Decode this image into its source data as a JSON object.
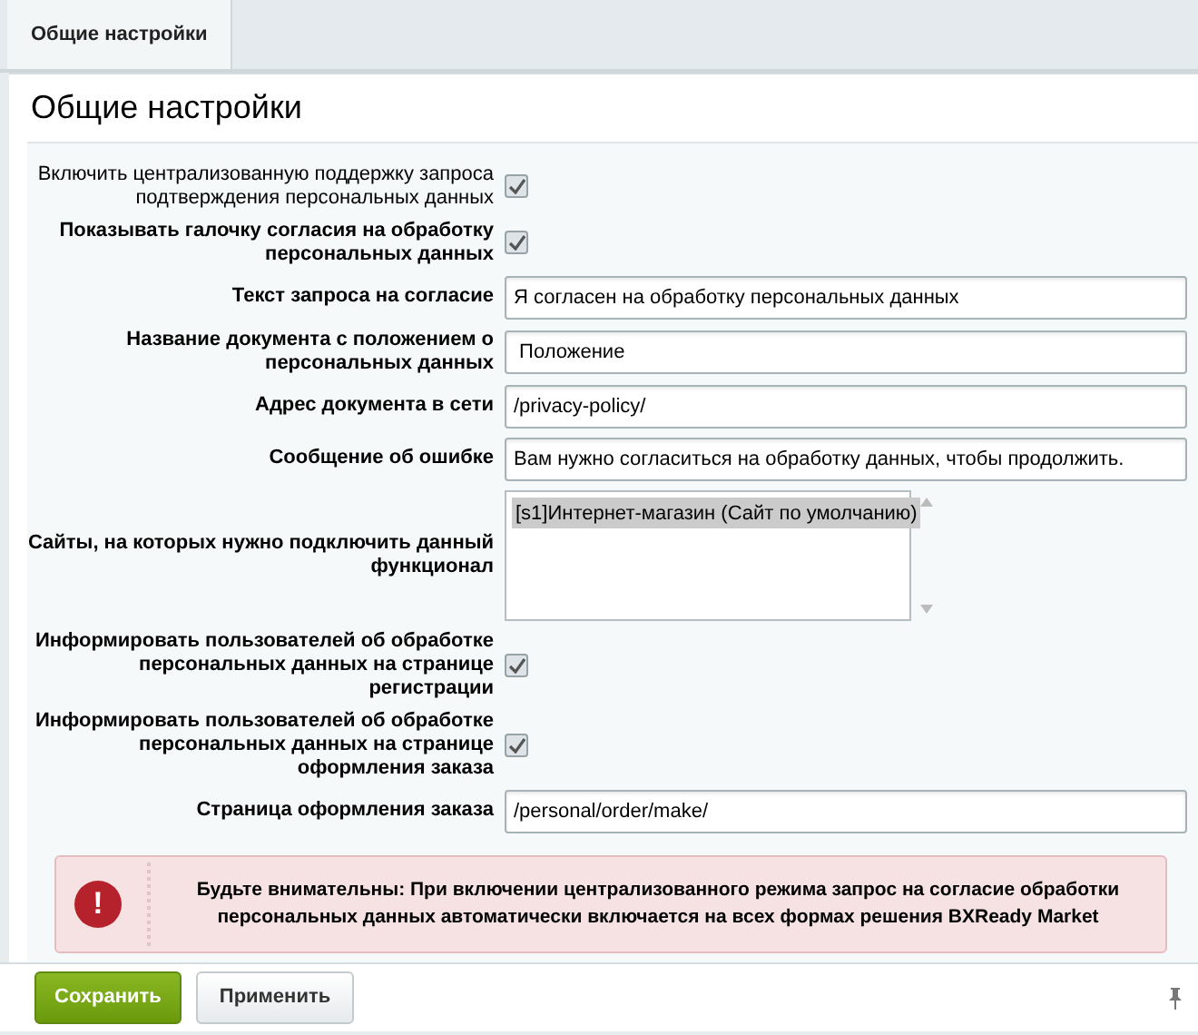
{
  "tabs": [
    {
      "label": "Общие настройки",
      "selected": true
    }
  ],
  "title": "Общие настройки",
  "fields": [
    {
      "kind": "checkbox",
      "label": "Включить централизованную поддержку запроса подтверждения персональных данных",
      "bold": false,
      "checked": true
    },
    {
      "kind": "checkbox",
      "label": "Показывать галочку согласия на обработку персональных данных",
      "bold": true,
      "checked": true
    },
    {
      "kind": "text",
      "label": "Текст запроса на согласие",
      "bold": true,
      "value": "Я согласен на обработку персональных данных"
    },
    {
      "kind": "text",
      "label": "Название документа с положением о персональных данных",
      "bold": true,
      "value": " Положение"
    },
    {
      "kind": "text",
      "label": "Адрес документа в сети",
      "bold": true,
      "value": "/privacy-policy/"
    },
    {
      "kind": "text",
      "label": "Сообщение об ошибке",
      "bold": true,
      "value": "Вам нужно согласиться на обработку данных, чтобы продолжить."
    },
    {
      "kind": "select",
      "label": "Сайты, на которых нужно подключить данный функционал",
      "bold": true,
      "options": [
        {
          "label": "[s1]Интернет-магазин (Сайт по умолчанию)",
          "selected": true
        }
      ]
    },
    {
      "kind": "checkbox",
      "label": "Информировать пользователей об обработке персональных данных на странице регистрации",
      "bold": true,
      "checked": true
    },
    {
      "kind": "checkbox",
      "label": "Информировать пользователей об обработке персональных данных на странице оформления заказа",
      "bold": true,
      "checked": true
    },
    {
      "kind": "text",
      "label": "Страница оформления заказа",
      "bold": true,
      "value": "/personal/order/make/"
    }
  ],
  "alert": {
    "icon": "!",
    "text": "Будьте внимательны: При включении централизованного режима запрос на согласие обработки персональных данных автоматически включается на всех формах решения BXReady Market"
  },
  "buttons": [
    {
      "label": "Сохранить",
      "kind": "primary"
    },
    {
      "label": "Применить",
      "kind": "secondary"
    }
  ]
}
